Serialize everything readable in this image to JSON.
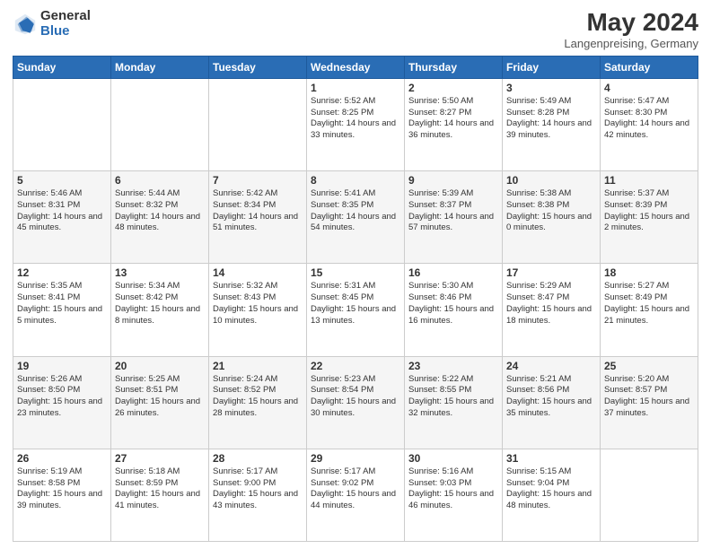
{
  "header": {
    "logo_general": "General",
    "logo_blue": "Blue",
    "month_year": "May 2024",
    "location": "Langenpreising, Germany"
  },
  "weekdays": [
    "Sunday",
    "Monday",
    "Tuesday",
    "Wednesday",
    "Thursday",
    "Friday",
    "Saturday"
  ],
  "weeks": [
    [
      {
        "day": "",
        "info": ""
      },
      {
        "day": "",
        "info": ""
      },
      {
        "day": "",
        "info": ""
      },
      {
        "day": "1",
        "info": "Sunrise: 5:52 AM\nSunset: 8:25 PM\nDaylight: 14 hours\nand 33 minutes."
      },
      {
        "day": "2",
        "info": "Sunrise: 5:50 AM\nSunset: 8:27 PM\nDaylight: 14 hours\nand 36 minutes."
      },
      {
        "day": "3",
        "info": "Sunrise: 5:49 AM\nSunset: 8:28 PM\nDaylight: 14 hours\nand 39 minutes."
      },
      {
        "day": "4",
        "info": "Sunrise: 5:47 AM\nSunset: 8:30 PM\nDaylight: 14 hours\nand 42 minutes."
      }
    ],
    [
      {
        "day": "5",
        "info": "Sunrise: 5:46 AM\nSunset: 8:31 PM\nDaylight: 14 hours\nand 45 minutes."
      },
      {
        "day": "6",
        "info": "Sunrise: 5:44 AM\nSunset: 8:32 PM\nDaylight: 14 hours\nand 48 minutes."
      },
      {
        "day": "7",
        "info": "Sunrise: 5:42 AM\nSunset: 8:34 PM\nDaylight: 14 hours\nand 51 minutes."
      },
      {
        "day": "8",
        "info": "Sunrise: 5:41 AM\nSunset: 8:35 PM\nDaylight: 14 hours\nand 54 minutes."
      },
      {
        "day": "9",
        "info": "Sunrise: 5:39 AM\nSunset: 8:37 PM\nDaylight: 14 hours\nand 57 minutes."
      },
      {
        "day": "10",
        "info": "Sunrise: 5:38 AM\nSunset: 8:38 PM\nDaylight: 15 hours\nand 0 minutes."
      },
      {
        "day": "11",
        "info": "Sunrise: 5:37 AM\nSunset: 8:39 PM\nDaylight: 15 hours\nand 2 minutes."
      }
    ],
    [
      {
        "day": "12",
        "info": "Sunrise: 5:35 AM\nSunset: 8:41 PM\nDaylight: 15 hours\nand 5 minutes."
      },
      {
        "day": "13",
        "info": "Sunrise: 5:34 AM\nSunset: 8:42 PM\nDaylight: 15 hours\nand 8 minutes."
      },
      {
        "day": "14",
        "info": "Sunrise: 5:32 AM\nSunset: 8:43 PM\nDaylight: 15 hours\nand 10 minutes."
      },
      {
        "day": "15",
        "info": "Sunrise: 5:31 AM\nSunset: 8:45 PM\nDaylight: 15 hours\nand 13 minutes."
      },
      {
        "day": "16",
        "info": "Sunrise: 5:30 AM\nSunset: 8:46 PM\nDaylight: 15 hours\nand 16 minutes."
      },
      {
        "day": "17",
        "info": "Sunrise: 5:29 AM\nSunset: 8:47 PM\nDaylight: 15 hours\nand 18 minutes."
      },
      {
        "day": "18",
        "info": "Sunrise: 5:27 AM\nSunset: 8:49 PM\nDaylight: 15 hours\nand 21 minutes."
      }
    ],
    [
      {
        "day": "19",
        "info": "Sunrise: 5:26 AM\nSunset: 8:50 PM\nDaylight: 15 hours\nand 23 minutes."
      },
      {
        "day": "20",
        "info": "Sunrise: 5:25 AM\nSunset: 8:51 PM\nDaylight: 15 hours\nand 26 minutes."
      },
      {
        "day": "21",
        "info": "Sunrise: 5:24 AM\nSunset: 8:52 PM\nDaylight: 15 hours\nand 28 minutes."
      },
      {
        "day": "22",
        "info": "Sunrise: 5:23 AM\nSunset: 8:54 PM\nDaylight: 15 hours\nand 30 minutes."
      },
      {
        "day": "23",
        "info": "Sunrise: 5:22 AM\nSunset: 8:55 PM\nDaylight: 15 hours\nand 32 minutes."
      },
      {
        "day": "24",
        "info": "Sunrise: 5:21 AM\nSunset: 8:56 PM\nDaylight: 15 hours\nand 35 minutes."
      },
      {
        "day": "25",
        "info": "Sunrise: 5:20 AM\nSunset: 8:57 PM\nDaylight: 15 hours\nand 37 minutes."
      }
    ],
    [
      {
        "day": "26",
        "info": "Sunrise: 5:19 AM\nSunset: 8:58 PM\nDaylight: 15 hours\nand 39 minutes."
      },
      {
        "day": "27",
        "info": "Sunrise: 5:18 AM\nSunset: 8:59 PM\nDaylight: 15 hours\nand 41 minutes."
      },
      {
        "day": "28",
        "info": "Sunrise: 5:17 AM\nSunset: 9:00 PM\nDaylight: 15 hours\nand 43 minutes."
      },
      {
        "day": "29",
        "info": "Sunrise: 5:17 AM\nSunset: 9:02 PM\nDaylight: 15 hours\nand 44 minutes."
      },
      {
        "day": "30",
        "info": "Sunrise: 5:16 AM\nSunset: 9:03 PM\nDaylight: 15 hours\nand 46 minutes."
      },
      {
        "day": "31",
        "info": "Sunrise: 5:15 AM\nSunset: 9:04 PM\nDaylight: 15 hours\nand 48 minutes."
      },
      {
        "day": "",
        "info": ""
      }
    ]
  ]
}
